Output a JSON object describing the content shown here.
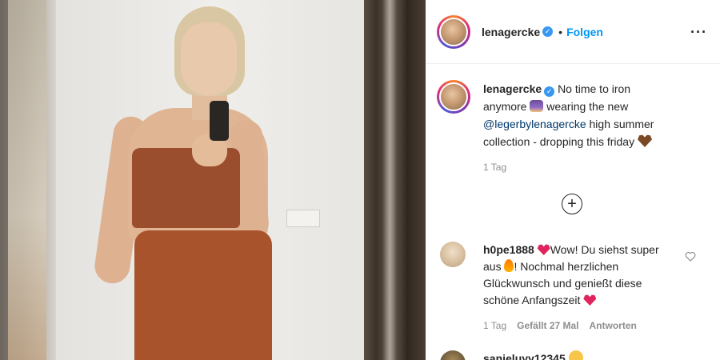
{
  "post": {
    "username": "lenagercke",
    "follow_label": "Folgen",
    "caption_line1": "No time to iron",
    "caption_line2_a": "anymore",
    "caption_line2_b": "wearing the new",
    "caption_mention": "@legerbylenagercke",
    "caption_line3_b": "high summer",
    "caption_line4": "collection - dropping this friday",
    "time": "1 Tag"
  },
  "comments": [
    {
      "username": "h0pe1888",
      "text_a": "Wow! Du siehst",
      "text_b": "super aus",
      "text_c": "! Nochmal herzlichen",
      "text_d": "Glückwunsch und genießt diese",
      "text_e": "schöne Anfangszeit",
      "time": "1 Tag",
      "likes": "Gefällt 27 Mal",
      "reply_label": "Antworten"
    },
    {
      "username": "sanjeluyy12345"
    }
  ],
  "icons": {
    "verified": "verified-badge-icon",
    "more": "more-options-icon",
    "load_more": "plus-circle-icon",
    "like": "heart-outline-icon"
  },
  "colors": {
    "accent": "#0095f6",
    "verified": "#3897f0",
    "muted": "#8e8e8e"
  }
}
